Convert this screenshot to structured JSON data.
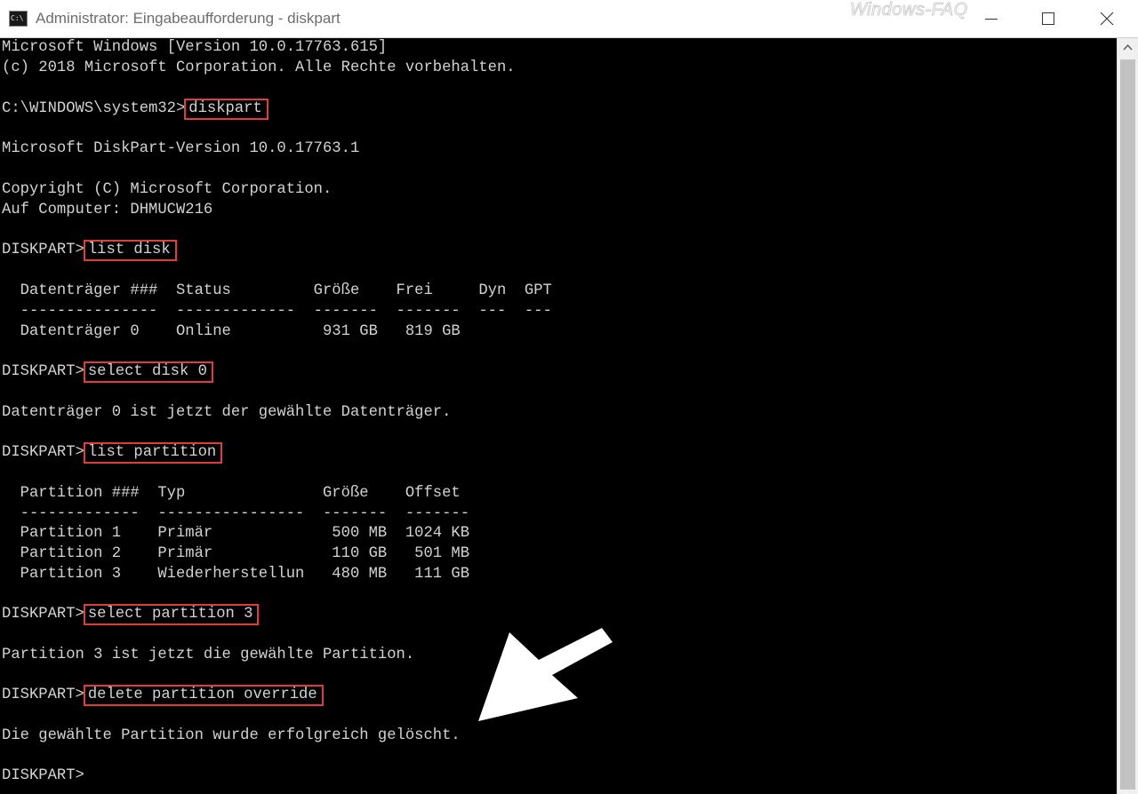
{
  "window": {
    "title": "Administrator: Eingabeaufforderung - diskpart",
    "icon_label": "C:\\",
    "watermark": "Windows-FAQ",
    "minimize_icon": "minimize-icon",
    "maximize_icon": "maximize-icon",
    "close_icon": "close-icon"
  },
  "console": {
    "header": [
      "Microsoft Windows [Version 10.0.17763.615]",
      "(c) 2018 Microsoft Corporation. Alle Rechte vorbehalten."
    ],
    "prompt_path": "C:\\WINDOWS\\system32>",
    "cmd_diskpart": "diskpart",
    "diskpart_version": "Microsoft DiskPart-Version 10.0.17763.1",
    "copyright": "Copyright (C) Microsoft Corporation.",
    "computer": "Auf Computer: DHMUCW216",
    "diskpart_prompt": "DISKPART>",
    "cmd_list_disk": "list disk",
    "disk_table": {
      "header": "  Datenträger ###  Status         Größe    Frei     Dyn  GPT",
      "separator": "  ---------------  -------------  -------  -------  ---  ---",
      "rows": [
        "  Datenträger 0    Online          931 GB   819 GB"
      ]
    },
    "cmd_select_disk": "select disk 0",
    "select_disk_result": "Datenträger 0 ist jetzt der gewählte Datenträger.",
    "cmd_list_partition": "list partition",
    "partition_table": {
      "header": "  Partition ###  Typ               Größe    Offset",
      "separator": "  -------------  ----------------  -------  -------",
      "rows": [
        "  Partition 1    Primär             500 MB  1024 KB",
        "  Partition 2    Primär             110 GB   501 MB",
        "  Partition 3    Wiederherstellun   480 MB   111 GB"
      ]
    },
    "cmd_select_partition": "select partition 3",
    "select_partition_result": "Partition 3 ist jetzt die gewählte Partition.",
    "cmd_delete_partition": "delete partition override",
    "delete_result": "Die gewählte Partition wurde erfolgreich gelöscht.",
    "final_prompt": "DISKPART>"
  },
  "colors": {
    "background": "#000000",
    "text": "#d2d2d2",
    "highlight_box": "#e23b3b",
    "annotation_arrow": "#ffffff"
  }
}
